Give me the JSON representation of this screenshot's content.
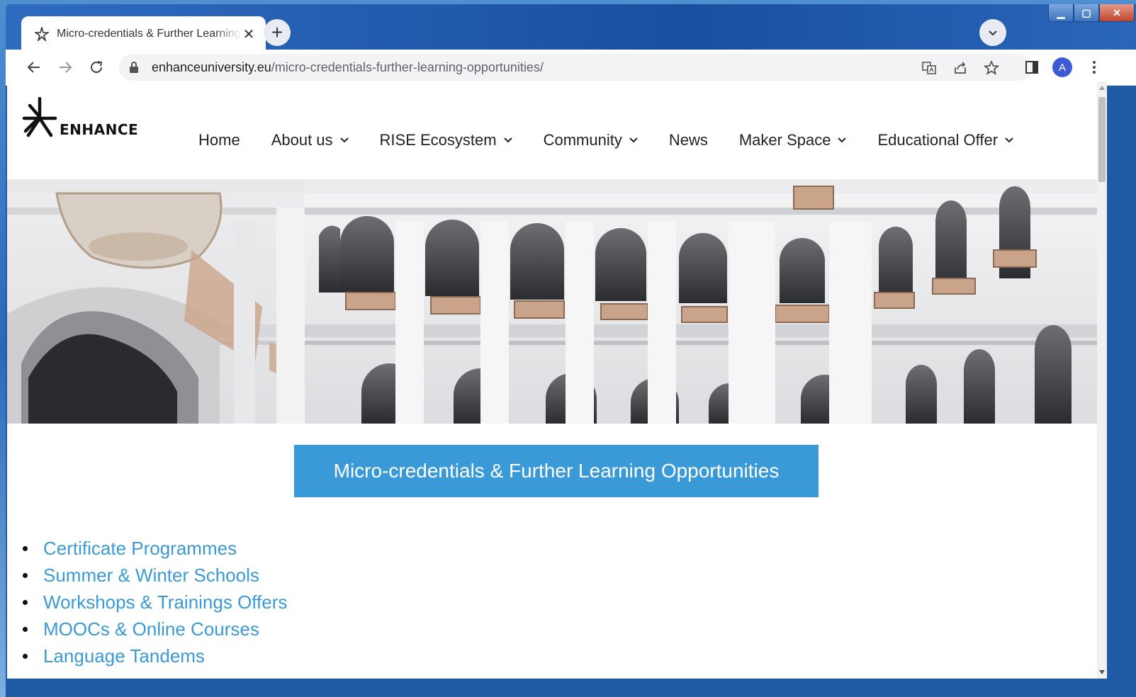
{
  "browser": {
    "tab_title": "Micro-credentials & Further Learning Opportunities",
    "url_host": "enhanceuniversity.eu",
    "url_path": "/micro-credentials-further-learning-opportunities/",
    "profile_initial": "A",
    "new_tab_symbol": "+",
    "close_tab_symbol": "✕",
    "window_controls": {
      "minimize": "▁",
      "maximize": "▢",
      "close": "✕"
    }
  },
  "site": {
    "logo_text": "ENHANCE",
    "nav": [
      {
        "label": "Home",
        "has_dropdown": false
      },
      {
        "label": "About us",
        "has_dropdown": true
      },
      {
        "label": "RISE Ecosystem",
        "has_dropdown": true
      },
      {
        "label": "Community",
        "has_dropdown": true
      },
      {
        "label": "News",
        "has_dropdown": false
      },
      {
        "label": "Maker Space",
        "has_dropdown": true
      },
      {
        "label": "Educational Offer",
        "has_dropdown": true
      }
    ],
    "banner_title": "Micro-credentials & Further Learning Opportunities",
    "links": [
      "Certificate Programmes",
      "Summer & Winter Schools",
      "Workshops & Trainings Offers",
      "MOOCs & Online Courses",
      "Language Tandems"
    ]
  },
  "colors": {
    "accent": "#3a9ad8",
    "link": "#3a9ad8",
    "titlebar": "#1f5ba5"
  }
}
